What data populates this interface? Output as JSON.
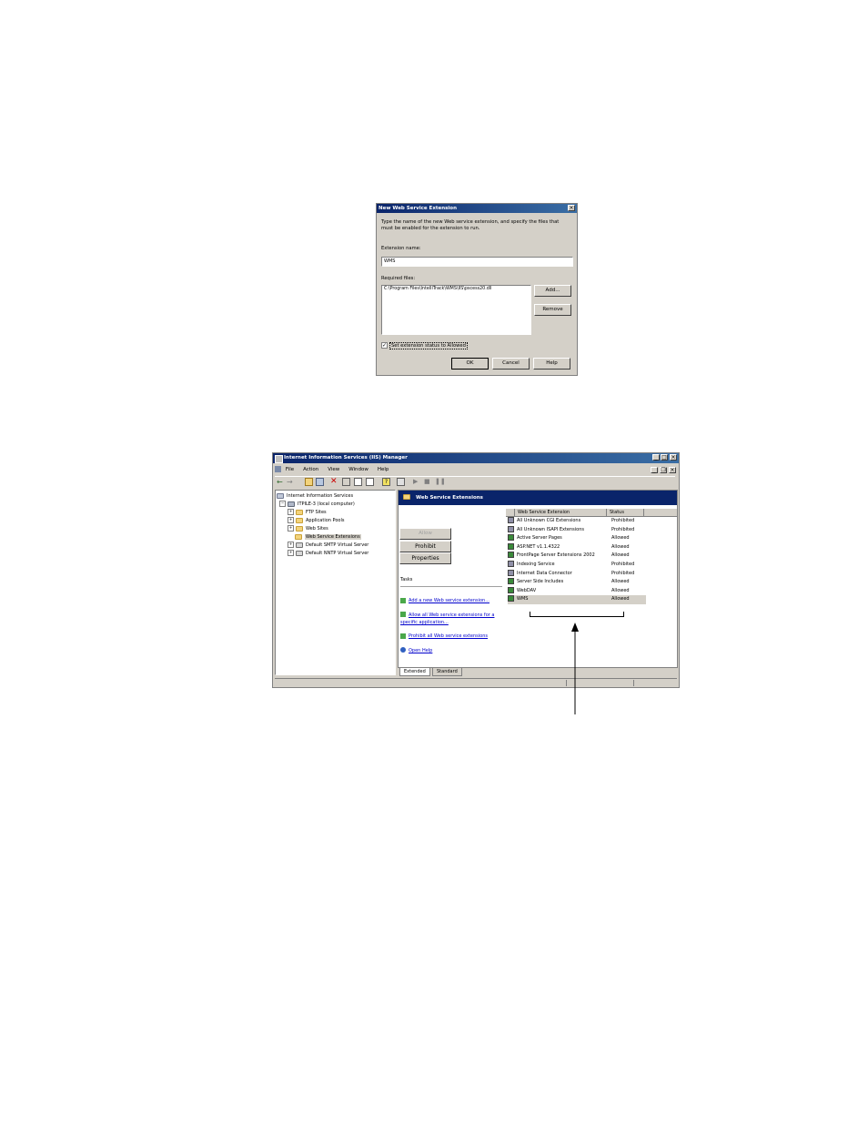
{
  "dialog": {
    "title": "New Web Service Extension",
    "close_glyph": "×",
    "instructions_line1": "Type the name of the new Web service extension, and specify the files that",
    "instructions_line2": "must be enabled for the extension to run.",
    "extension_name_label": "Extension name:",
    "extension_name_value": "WMS",
    "required_files_label": "Required files:",
    "required_file": "C:\\Program Files\\IntelliTrack\\WMS\\IIS\\pscess20.dll",
    "add_label": "Add...",
    "remove_label": "Remove",
    "checkbox_label": "Set extension status to Allowed",
    "checkbox_checked": true,
    "ok_label": "OK",
    "cancel_label": "Cancel",
    "help_label": "Help"
  },
  "iis": {
    "title": "Internet Information Services (IIS) Manager",
    "menu": [
      "File",
      "Action",
      "View",
      "Window",
      "Help"
    ],
    "tree": {
      "root": "Internet Information Services",
      "computer": "ITPILE-3 (local computer)",
      "items": [
        "FTP Sites",
        "Application Pools",
        "Web Sites",
        "Web Service Extensions",
        "Default SMTP Virtual Server",
        "Default NNTP Virtual Server"
      ]
    },
    "panel_title": "Web Service Extensions",
    "buttons": {
      "allow": "Allow",
      "prohibit": "Prohibit",
      "properties": "Properties"
    },
    "tasks_label": "Tasks",
    "tasks": {
      "add": "Add a new Web service extension...",
      "allow_line1": "Allow all Web service extensions for a",
      "allow_line2": "specific application...",
      "prohibit": "Prohibit all Web service extensions",
      "help": "Open Help"
    },
    "columns": {
      "name": "Web Service Extension",
      "status": "Status"
    },
    "extensions": [
      {
        "name": "All Unknown CGI Extensions",
        "status": "Prohibited"
      },
      {
        "name": "All Unknown ISAPI Extensions",
        "status": "Prohibited"
      },
      {
        "name": "Active Server Pages",
        "status": "Allowed"
      },
      {
        "name": "ASP.NET v1.1.4322",
        "status": "Allowed"
      },
      {
        "name": "FrontPage Server Extensions 2002",
        "status": "Allowed"
      },
      {
        "name": "Indexing Service",
        "status": "Prohibited"
      },
      {
        "name": "Internet Data Connector",
        "status": "Prohibited"
      },
      {
        "name": "Server Side Includes",
        "status": "Allowed"
      },
      {
        "name": "WebDAV",
        "status": "Allowed"
      },
      {
        "name": "WMS",
        "status": "Allowed"
      }
    ],
    "tabs": {
      "extended": "Extended",
      "standard": "Standard"
    }
  }
}
